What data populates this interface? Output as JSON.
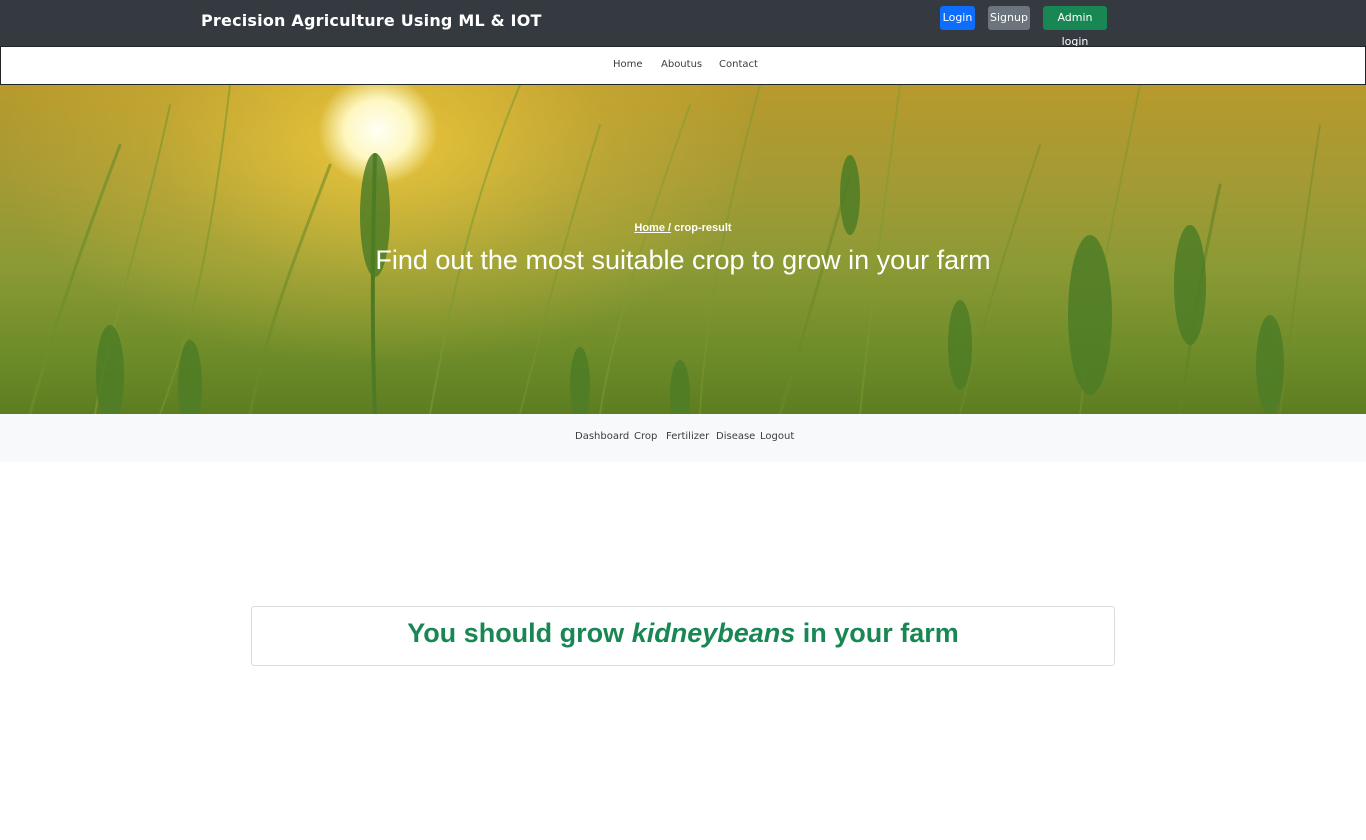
{
  "header": {
    "brand": "Precision Agriculture Using ML & IOT",
    "buttons": {
      "login": "Login",
      "signup": "Signup",
      "admin_login": "Admin login"
    }
  },
  "nav": {
    "home": "Home",
    "about": "Aboutus",
    "contact": "Contact"
  },
  "hero": {
    "breadcrumb_home": "Home /",
    "breadcrumb_current": "crop-result",
    "title": "Find out the most suitable crop to grow in your farm"
  },
  "subnav": {
    "dashboard": "Dashboard",
    "crop": "Crop",
    "fertilizer": "Fertilizer",
    "disease": "Disease",
    "logout": "Logout"
  },
  "result": {
    "prefix": "You should grow",
    "crop": "kidneybeans",
    "suffix": "in your farm"
  },
  "colors": {
    "topbar": "#343a40",
    "login_button": "#0d6efd",
    "signup_button": "#6c757d",
    "admin_button": "#198754",
    "result_text": "#198754"
  }
}
